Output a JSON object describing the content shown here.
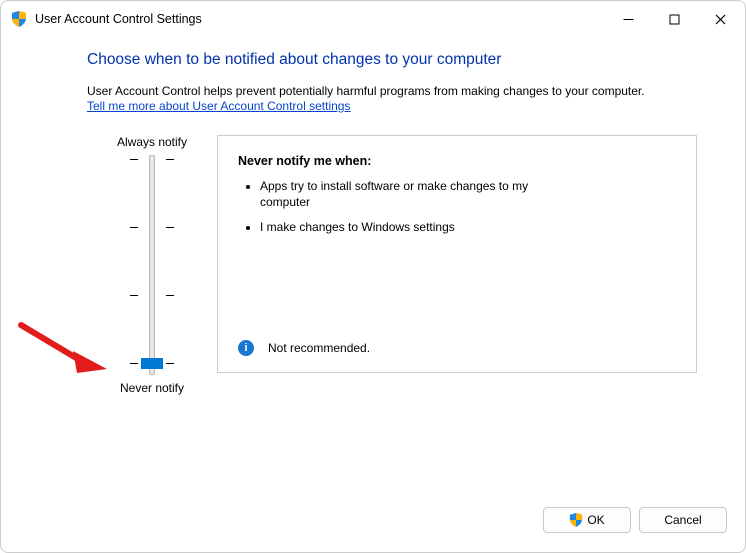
{
  "window": {
    "title": "User Account Control Settings"
  },
  "heading": "Choose when to be notified about changes to your computer",
  "description": "User Account Control helps prevent potentially harmful programs from making changes to your computer.",
  "link_text": "Tell me more about User Account Control settings",
  "slider": {
    "top_label": "Always notify",
    "bottom_label": "Never notify",
    "level_count": 4,
    "current_level": 0
  },
  "panel": {
    "title": "Never notify me when:",
    "bullets": [
      "Apps try to install software or make changes to my computer",
      "I make changes to Windows settings"
    ],
    "recommendation": "Not recommended."
  },
  "buttons": {
    "ok": "OK",
    "cancel": "Cancel"
  },
  "icons": {
    "shield": "uac-shield",
    "info": "i"
  }
}
